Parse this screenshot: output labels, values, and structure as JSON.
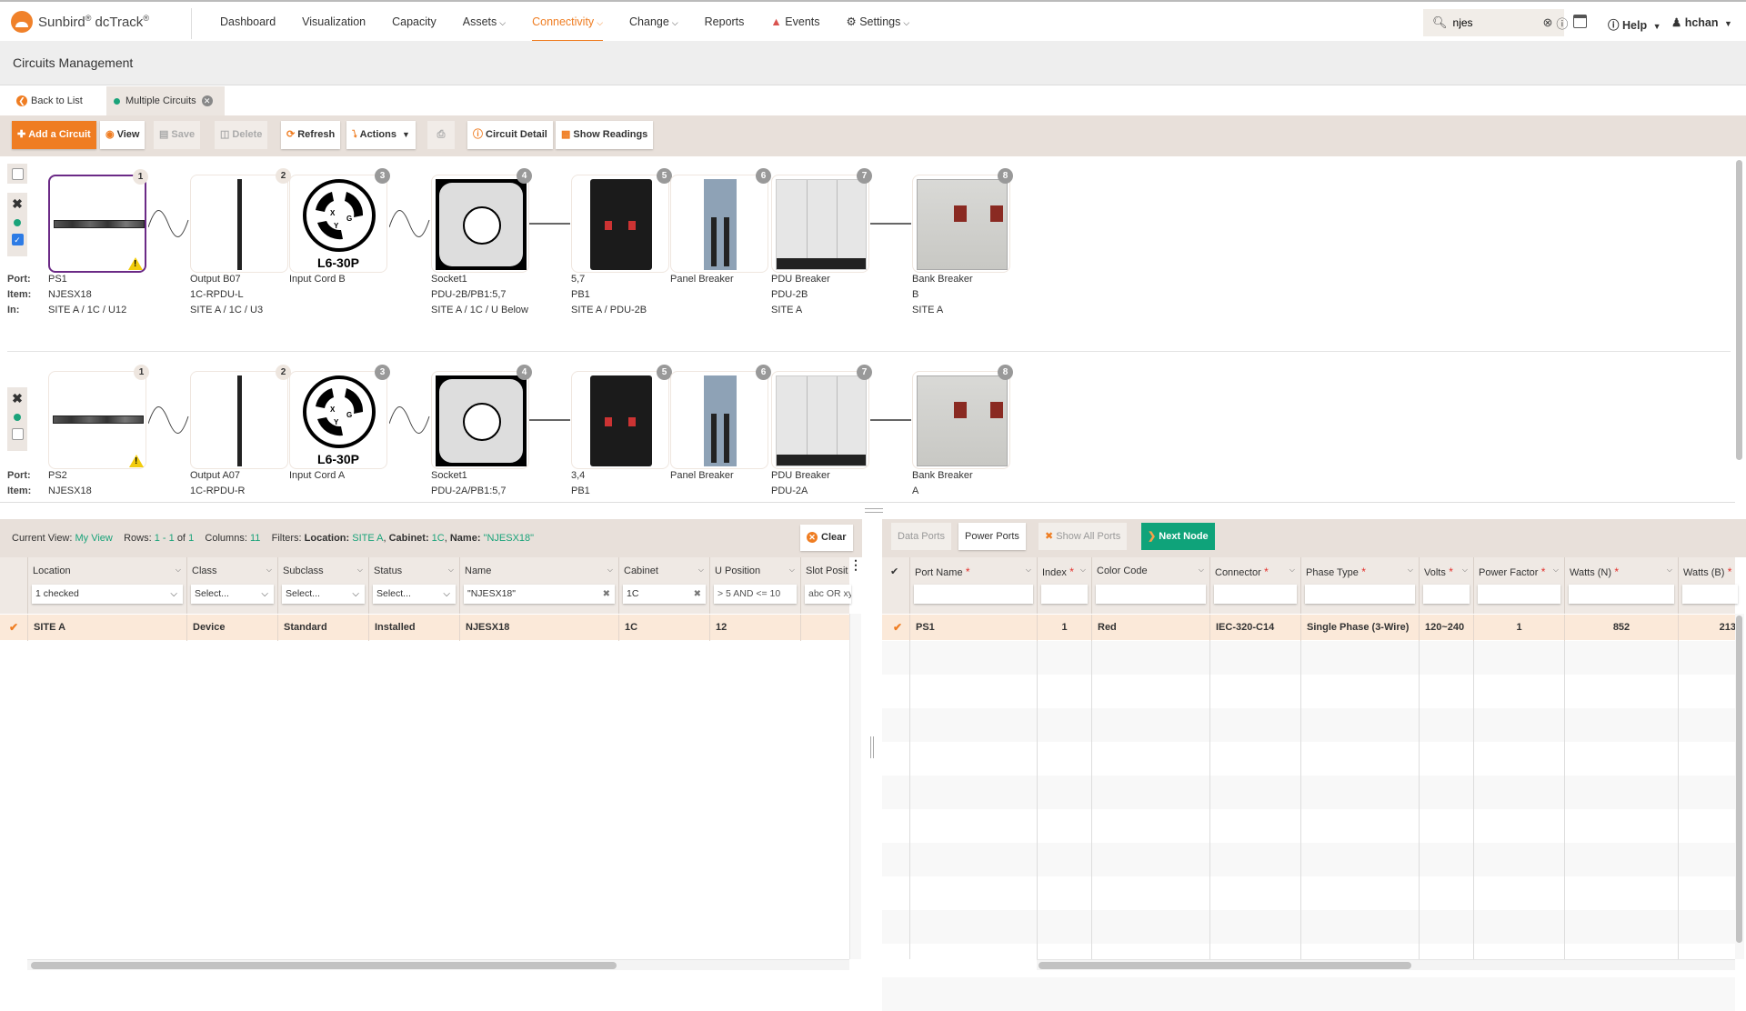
{
  "app": {
    "brand": "Sunbird",
    "product": "dcTrack",
    "nav": [
      {
        "label": "Dashboard",
        "dropdown": false,
        "active": false
      },
      {
        "label": "Visualization",
        "dropdown": false,
        "active": false
      },
      {
        "label": "Capacity",
        "dropdown": false,
        "active": false
      },
      {
        "label": "Assets",
        "dropdown": true,
        "active": false
      },
      {
        "label": "Connectivity",
        "dropdown": true,
        "active": true
      },
      {
        "label": "Change",
        "dropdown": true,
        "active": false
      },
      {
        "label": "Reports",
        "dropdown": false,
        "active": false
      },
      {
        "label": "Events",
        "dropdown": false,
        "active": false
      },
      {
        "label": "Settings",
        "dropdown": true,
        "active": false
      }
    ],
    "search": {
      "value": "njes"
    },
    "help_label": "Help",
    "user": "hchan",
    "accent_color": "#ef7d22"
  },
  "page": {
    "title": "Circuits Management",
    "tabs": {
      "back": "Back to List",
      "current": "Multiple Circuits"
    }
  },
  "toolbar": {
    "add": "Add a Circuit",
    "view": "View",
    "save": "Save",
    "delete": "Delete",
    "refresh": "Refresh",
    "actions": "Actions",
    "circuit_detail": "Circuit Detail",
    "show_readings": "Show Readings"
  },
  "circuit_labels": {
    "port": "Port:",
    "item": "Item:",
    "in": "In:"
  },
  "circuits": [
    {
      "checked": true,
      "nodes": [
        {
          "n": "1",
          "line1": "PS1",
          "line2": "NJESX18",
          "line3": "SITE A / 1C / U12"
        },
        {
          "n": "2",
          "line1": "Output B07",
          "line2": "1C-RPDU-L",
          "line3": "SITE A / 1C / U3"
        },
        {
          "n": "3",
          "line1": "Input Cord B",
          "line2": "",
          "line3": "",
          "plug": "L6-30P"
        },
        {
          "n": "4",
          "line1": "Socket1",
          "line2": "PDU-2B/PB1:5,7",
          "line3": "SITE A / 1C / U Below"
        },
        {
          "n": "5",
          "line1": "5,7",
          "line2": "PB1",
          "line3": "SITE A / PDU-2B"
        },
        {
          "n": "6",
          "line1": "Panel Breaker",
          "line2": "",
          "line3": ""
        },
        {
          "n": "7",
          "line1": "PDU Breaker",
          "line2": "PDU-2B",
          "line3": "SITE A"
        },
        {
          "n": "8",
          "line1": "Bank Breaker",
          "line2": "B",
          "line3": "SITE A"
        }
      ]
    },
    {
      "checked": false,
      "nodes": [
        {
          "n": "1",
          "line1": "PS2",
          "line2": "NJESX18"
        },
        {
          "n": "2",
          "line1": "Output A07",
          "line2": "1C-RPDU-R"
        },
        {
          "n": "3",
          "line1": "Input Cord A",
          "line2": "",
          "plug": "L6-30P"
        },
        {
          "n": "4",
          "line1": "Socket1",
          "line2": "PDU-2A/PB1:5,7"
        },
        {
          "n": "5",
          "line1": "3,4",
          "line2": "PB1"
        },
        {
          "n": "6",
          "line1": "Panel Breaker",
          "line2": ""
        },
        {
          "n": "7",
          "line1": "PDU Breaker",
          "line2": "PDU-2A"
        },
        {
          "n": "8",
          "line1": "Bank Breaker",
          "line2": "A"
        }
      ]
    }
  ],
  "items_grid": {
    "info": {
      "current_view_label": "Current View:",
      "current_view": "My View",
      "rows_label": "Rows:",
      "rows_range": "1 - 1",
      "of": "of",
      "rows_total": "1",
      "columns_label": "Columns:",
      "columns": "11",
      "filters_label": "Filters:",
      "f1_key": "Location:",
      "f1_val": "SITE A",
      "f2_key": "Cabinet:",
      "f2_val": "1C",
      "f3_key": "Name:",
      "f3_val": "\"NJESX18\""
    },
    "clear_label": "Clear",
    "columns": [
      {
        "header": "Location",
        "filter": "1 checked"
      },
      {
        "header": "Class",
        "filter": "Select..."
      },
      {
        "header": "Subclass",
        "filter": "Select..."
      },
      {
        "header": "Status",
        "filter": "Select..."
      },
      {
        "header": "Name",
        "filter": "\"NJESX18\""
      },
      {
        "header": "Cabinet",
        "filter": "1C"
      },
      {
        "header": "U Position",
        "filter": "> 5 AND <= 10"
      },
      {
        "header": "Slot Posit",
        "filter": "abc OR xyz*."
      }
    ],
    "rows": [
      [
        "SITE A",
        "Device",
        "Standard",
        "Installed",
        "NJESX18",
        "1C",
        "12",
        ""
      ]
    ]
  },
  "ports_grid": {
    "buttons": {
      "data_ports": "Data Ports",
      "power_ports": "Power Ports",
      "show_all": "Show All Ports",
      "next_node": "Next Node"
    },
    "columns": [
      {
        "header": "Port Name",
        "required": true
      },
      {
        "header": "Index",
        "required": true
      },
      {
        "header": "Color Code",
        "required": false
      },
      {
        "header": "Connector",
        "required": true
      },
      {
        "header": "Phase Type",
        "required": true
      },
      {
        "header": "Volts",
        "required": true
      },
      {
        "header": "Power Factor",
        "required": true
      },
      {
        "header": "Watts (N)",
        "required": true
      },
      {
        "header": "Watts (B)",
        "required": true
      }
    ],
    "rows": [
      [
        "PS1",
        "1",
        "Red",
        "IEC-320-C14",
        "Single Phase (3-Wire)",
        "120~240",
        "1",
        "852",
        "213"
      ]
    ]
  }
}
